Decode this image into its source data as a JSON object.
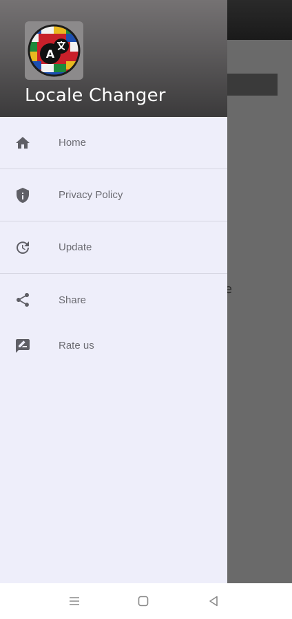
{
  "app": {
    "title": "Locale Changer"
  },
  "background": {
    "partial_text": "e"
  },
  "drawer": {
    "items": [
      {
        "label": "Home",
        "icon": "home-icon"
      },
      {
        "label": "Privacy Policy",
        "icon": "shield-icon"
      },
      {
        "label": "Update",
        "icon": "update-icon"
      },
      {
        "label": "Share",
        "icon": "share-icon"
      },
      {
        "label": "Rate us",
        "icon": "rate-review-icon"
      }
    ]
  },
  "navbar": {
    "buttons": [
      "recents-icon",
      "home-square-icon",
      "back-triangle-icon"
    ]
  },
  "colors": {
    "drawer_bg": "#eeeefa",
    "header_gradient_top": "#757273",
    "header_gradient_bottom": "#3b3a3b",
    "icon_color": "#5f5f66",
    "label_color": "#6b6b72"
  }
}
